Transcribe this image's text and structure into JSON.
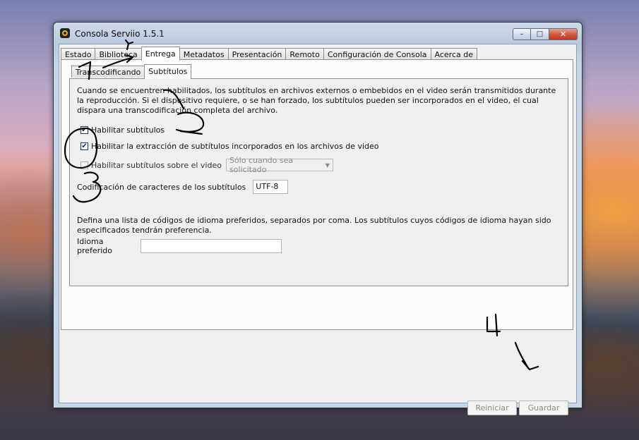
{
  "window": {
    "title": "Consola Serviio 1.5.1",
    "controls": {
      "minimize": "–",
      "maximize": "□",
      "close": "✕"
    }
  },
  "main_tabs": [
    {
      "label": "Estado"
    },
    {
      "label": "Biblioteca"
    },
    {
      "label": "Entrega"
    },
    {
      "label": "Metadatos"
    },
    {
      "label": "Presentación"
    },
    {
      "label": "Remoto"
    },
    {
      "label": "Configuración de Consola"
    },
    {
      "label": "Acerca de"
    }
  ],
  "sub_tabs": [
    {
      "label": "Transcodificando"
    },
    {
      "label": "Subtítulos"
    }
  ],
  "subtitles": {
    "description": "Cuando se encuentren habilitados, los subtítulos en archivos externos o embebidos en el video serán transmitidos durante la reproducción. Si el dispositivo requiere, o se han forzado, los subtítulos pueden ser incorporados en el video, el cual dispara una transcodificación completa del archivo.",
    "enable_subtitles": {
      "label": "Habilitar subtítulos",
      "checked": true
    },
    "enable_extraction": {
      "label": "Habilitar la extracción de subtítulos incorporados en los archivos de video",
      "checked": true
    },
    "burn_subtitles": {
      "label": "Habilitar subtítulos sobre el video",
      "checked": false,
      "option": "Sólo cuando sea solicitado"
    },
    "encoding": {
      "label": "Codificación de caracteres de los subtítulos",
      "value": "UTF-8"
    },
    "language_description": "Defina una lista de códigos de idioma preferidos, separados por coma. Los subtítulos cuyos códigos de idioma hayan sido especificados tendrán preferencia.",
    "preferred_language": {
      "label": "Idioma preferido",
      "value": ""
    }
  },
  "buttons": {
    "reset": "Reiniciar",
    "save": "Guardar"
  },
  "annotations": {
    "n1": "1",
    "n2": "2",
    "n3": "3",
    "n4": "4"
  }
}
